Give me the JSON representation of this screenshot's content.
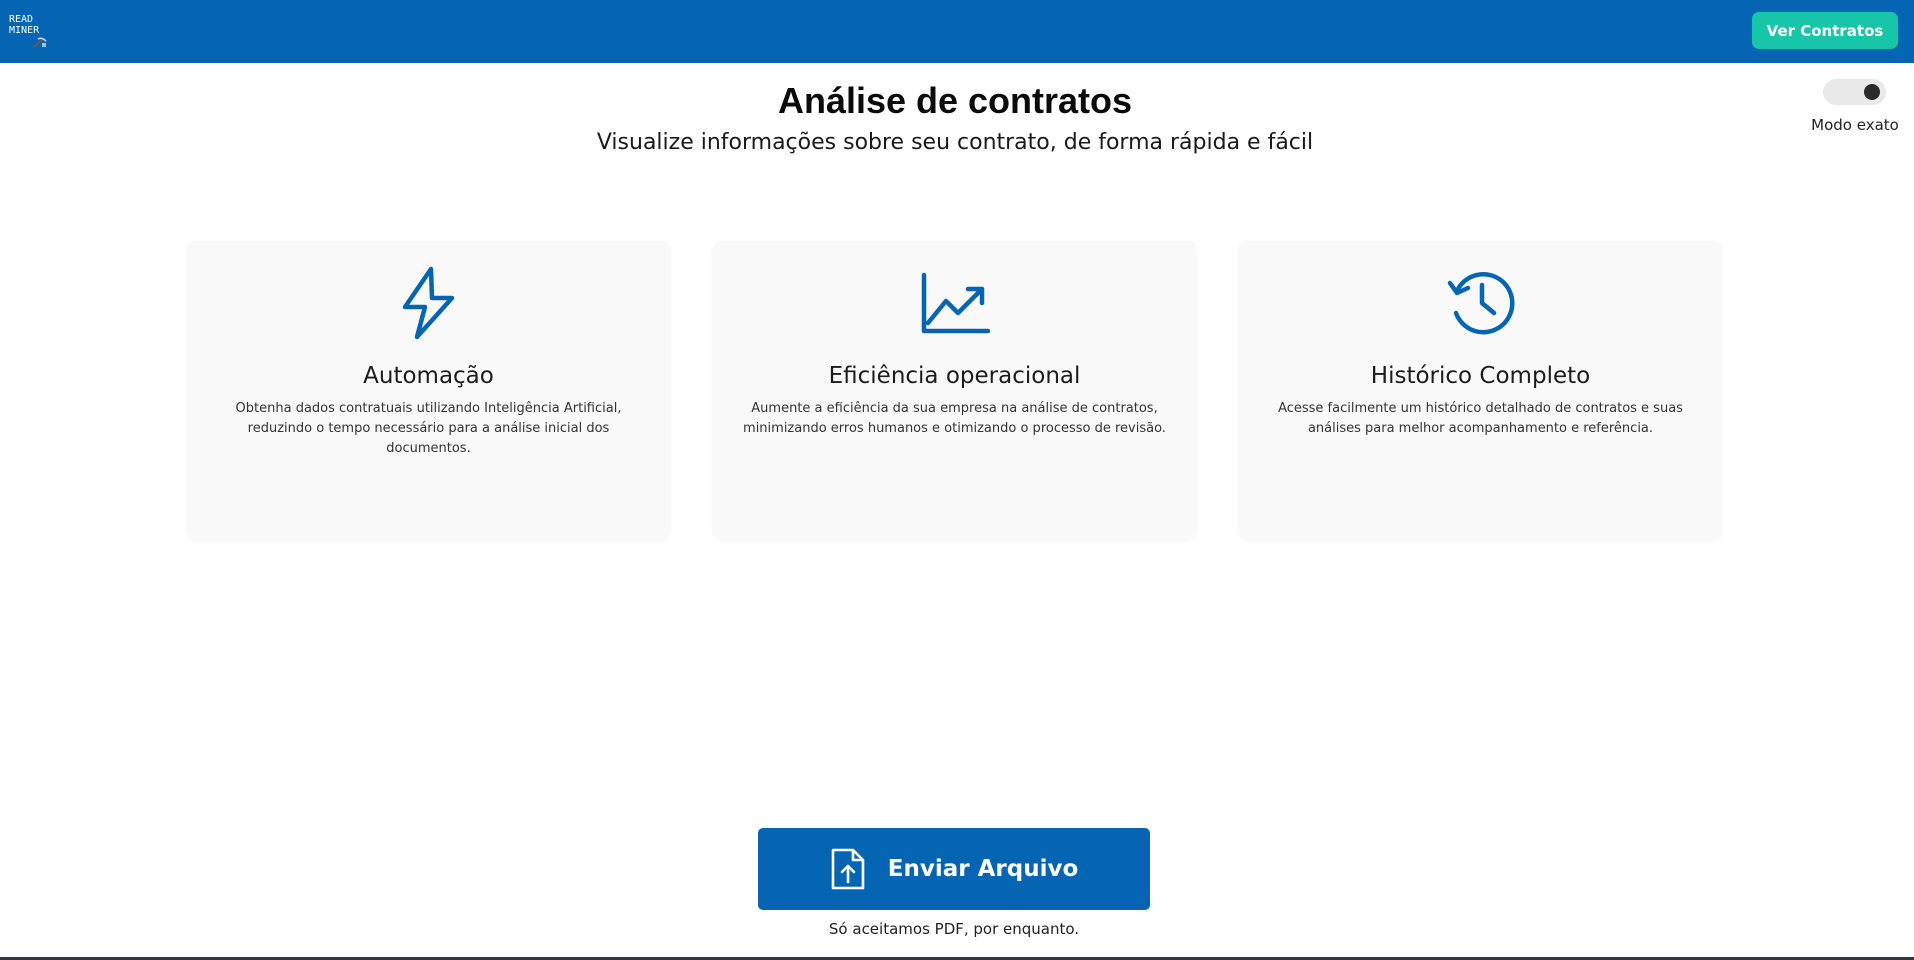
{
  "header": {
    "logo": {
      "line1": "READ",
      "line2": "MINER",
      "icon": "pickaxe-icon"
    },
    "ver_contratos_label": "Ver Contratos",
    "colors": {
      "bar": "#0565b2",
      "button": "#17c6a9"
    }
  },
  "hero": {
    "title": "Análise de contratos",
    "subtitle": "Visualize informações sobre seu contrato, de forma rápida e fácil"
  },
  "toggle": {
    "label": "Modo exato",
    "checked": true
  },
  "features": [
    {
      "icon": "lightning-bolt-icon",
      "title": "Automação",
      "description": "Obtenha dados contratuais utilizando Inteligência Artificial, reduzindo o tempo necessário para a análise inicial dos documentos."
    },
    {
      "icon": "chart-trend-icon",
      "title": "Eficiência operacional",
      "description": "Aumente a eficiência da sua empresa na análise de contratos, minimizando erros humanos e otimizando o processo de revisão."
    },
    {
      "icon": "history-clock-icon",
      "title": "Histórico Completo",
      "description": "Acesse facilmente um histórico detalhado de contratos e suas análises para melhor acompanhamento e referência."
    }
  ],
  "upload": {
    "icon": "file-upload-icon",
    "button_label": "Enviar Arquivo",
    "note": "Só aceitamos PDF, por enquanto."
  },
  "accent_color": "#0565b2"
}
